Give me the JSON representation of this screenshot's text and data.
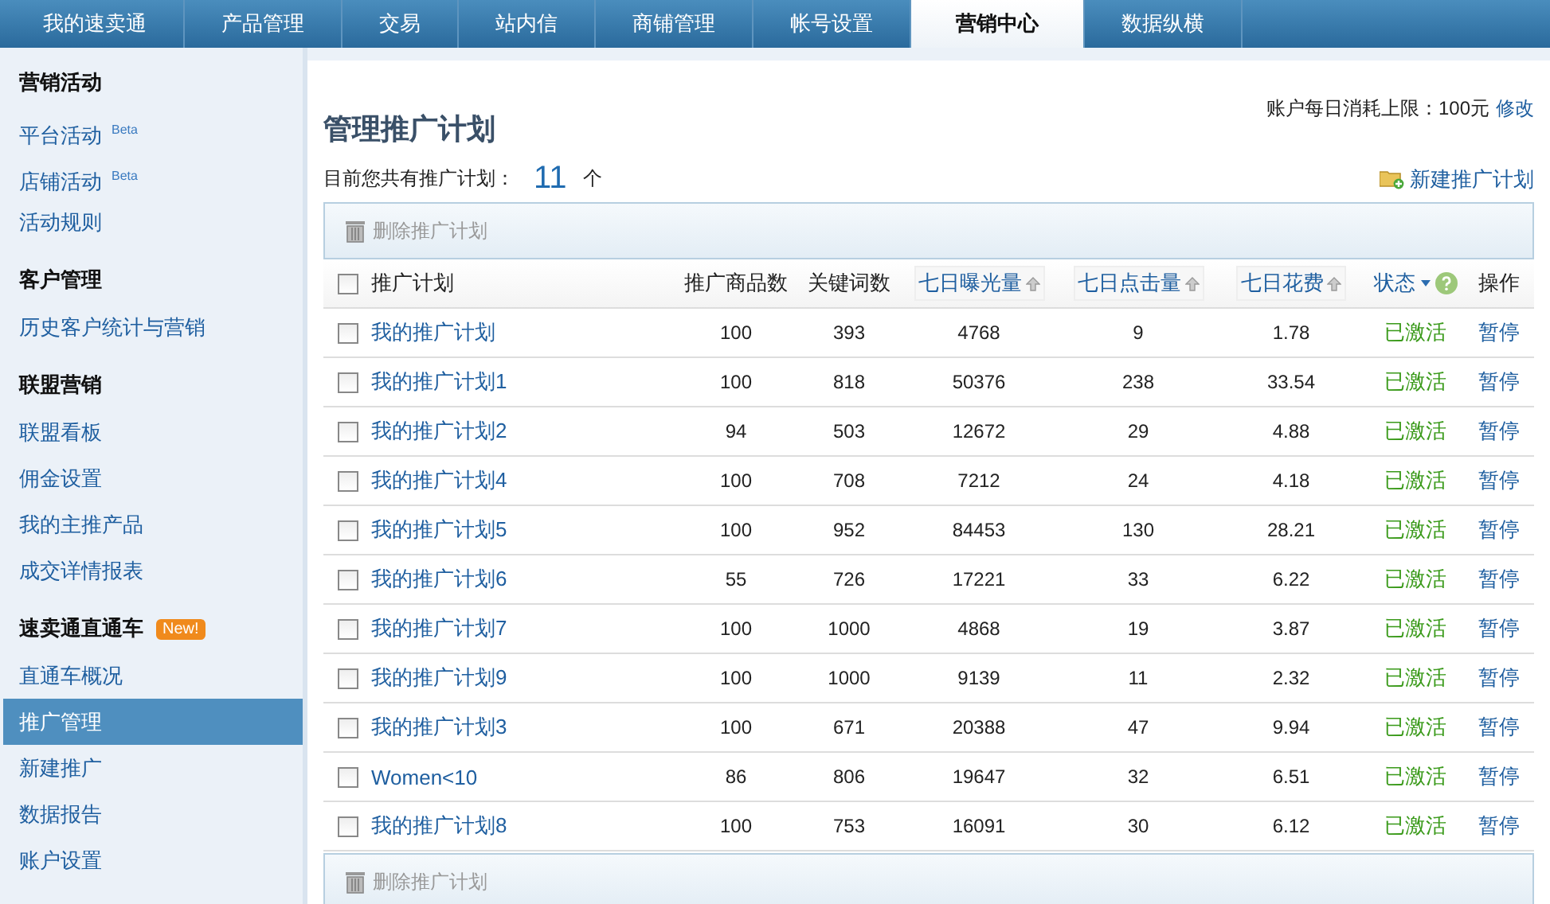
{
  "nav_tabs": [
    {
      "label": "我的速卖通",
      "selected": false
    },
    {
      "label": "产品管理",
      "selected": false
    },
    {
      "label": "交易",
      "selected": false
    },
    {
      "label": "站内信",
      "selected": false
    },
    {
      "label": "商铺管理",
      "selected": false
    },
    {
      "label": "帐号设置",
      "selected": false
    },
    {
      "label": "营销中心",
      "selected": true
    },
    {
      "label": "数据纵横",
      "selected": false
    }
  ],
  "sidebar": {
    "sections": [
      {
        "title": "营销活动",
        "items": [
          {
            "label": "平台活动",
            "badge": "Beta",
            "selected": false
          },
          {
            "label": "店铺活动",
            "badge": "Beta",
            "selected": false
          },
          {
            "label": "活动规则",
            "selected": false
          }
        ]
      },
      {
        "title": "客户管理",
        "items": [
          {
            "label": "历史客户统计与营销",
            "selected": false
          }
        ]
      },
      {
        "title": "联盟营销",
        "items": [
          {
            "label": "联盟看板",
            "selected": false
          },
          {
            "label": "佣金设置",
            "selected": false
          },
          {
            "label": "我的主推产品",
            "selected": false
          },
          {
            "label": "成交详情报表",
            "selected": false
          }
        ]
      },
      {
        "title": "速卖通直通车",
        "badge": "New!",
        "items": [
          {
            "label": "直通车概况",
            "selected": false
          },
          {
            "label": "推广管理",
            "selected": true
          },
          {
            "label": "新建推广",
            "selected": false
          },
          {
            "label": "数据报告",
            "selected": false
          },
          {
            "label": "账户设置",
            "selected": false
          }
        ]
      }
    ]
  },
  "page_title": "管理推广计划",
  "budget": {
    "label": "账户每日消耗上限：100元",
    "link": "修改"
  },
  "plan_count": {
    "label": "目前您共有推广计划：",
    "count": "11",
    "unit": "个"
  },
  "new_plan_button": "新建推广计划",
  "delete_button": "删除推广计划",
  "table": {
    "select_all_checked": false,
    "columns": [
      {
        "label": "推广计划",
        "kind": "plain"
      },
      {
        "label": "推广商品数",
        "kind": "plain"
      },
      {
        "label": "关键词数",
        "kind": "plain"
      },
      {
        "label": "七日曝光量",
        "kind": "sort"
      },
      {
        "label": "七日点击量",
        "kind": "sort"
      },
      {
        "label": "七日花费",
        "kind": "sort"
      },
      {
        "label": "状态",
        "kind": "filter"
      },
      {
        "label": "操作",
        "kind": "plain"
      }
    ],
    "rows": [
      {
        "checked": false,
        "cells": [
          "我的推广计划",
          "100",
          "393",
          "4768",
          "9",
          "1.78",
          "已激活",
          "暂停"
        ]
      },
      {
        "checked": false,
        "cells": [
          "我的推广计划1",
          "100",
          "818",
          "50376",
          "238",
          "33.54",
          "已激活",
          "暂停"
        ]
      },
      {
        "checked": false,
        "cells": [
          "我的推广计划2",
          "94",
          "503",
          "12672",
          "29",
          "4.88",
          "已激活",
          "暂停"
        ]
      },
      {
        "checked": false,
        "cells": [
          "我的推广计划4",
          "100",
          "708",
          "7212",
          "24",
          "4.18",
          "已激活",
          "暂停"
        ]
      },
      {
        "checked": false,
        "cells": [
          "我的推广计划5",
          "100",
          "952",
          "84453",
          "130",
          "28.21",
          "已激活",
          "暂停"
        ]
      },
      {
        "checked": false,
        "cells": [
          "我的推广计划6",
          "55",
          "726",
          "17221",
          "33",
          "6.22",
          "已激活",
          "暂停"
        ]
      },
      {
        "checked": false,
        "cells": [
          "我的推广计划7",
          "100",
          "1000",
          "4868",
          "19",
          "3.87",
          "已激活",
          "暂停"
        ]
      },
      {
        "checked": false,
        "cells": [
          "我的推广计划9",
          "100",
          "1000",
          "9139",
          "11",
          "2.32",
          "已激活",
          "暂停"
        ]
      },
      {
        "checked": false,
        "cells": [
          "我的推广计划3",
          "100",
          "671",
          "20388",
          "47",
          "9.94",
          "已激活",
          "暂停"
        ]
      },
      {
        "checked": false,
        "cells": [
          "Women<10",
          "86",
          "806",
          "19647",
          "32",
          "6.51",
          "已激活",
          "暂停"
        ]
      },
      {
        "checked": false,
        "cells": [
          "我的推广计划8",
          "100",
          "753",
          "16091",
          "30",
          "6.12",
          "已激活",
          "暂停"
        ]
      }
    ]
  },
  "bottom_delete_button": "删除推广计划"
}
